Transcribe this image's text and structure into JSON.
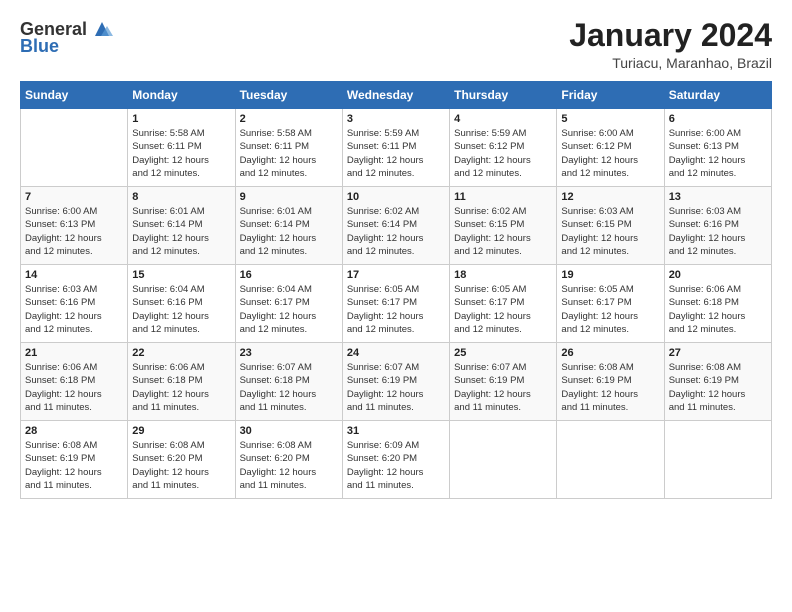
{
  "logo": {
    "general": "General",
    "blue": "Blue"
  },
  "title": "January 2024",
  "subtitle": "Turiacu, Maranhao, Brazil",
  "days_of_week": [
    "Sunday",
    "Monday",
    "Tuesday",
    "Wednesday",
    "Thursday",
    "Friday",
    "Saturday"
  ],
  "weeks": [
    [
      {
        "day": "",
        "info": ""
      },
      {
        "day": "1",
        "info": "Sunrise: 5:58 AM\nSunset: 6:11 PM\nDaylight: 12 hours\nand 12 minutes."
      },
      {
        "day": "2",
        "info": "Sunrise: 5:58 AM\nSunset: 6:11 PM\nDaylight: 12 hours\nand 12 minutes."
      },
      {
        "day": "3",
        "info": "Sunrise: 5:59 AM\nSunset: 6:11 PM\nDaylight: 12 hours\nand 12 minutes."
      },
      {
        "day": "4",
        "info": "Sunrise: 5:59 AM\nSunset: 6:12 PM\nDaylight: 12 hours\nand 12 minutes."
      },
      {
        "day": "5",
        "info": "Sunrise: 6:00 AM\nSunset: 6:12 PM\nDaylight: 12 hours\nand 12 minutes."
      },
      {
        "day": "6",
        "info": "Sunrise: 6:00 AM\nSunset: 6:13 PM\nDaylight: 12 hours\nand 12 minutes."
      }
    ],
    [
      {
        "day": "7",
        "info": "Sunrise: 6:00 AM\nSunset: 6:13 PM\nDaylight: 12 hours\nand 12 minutes."
      },
      {
        "day": "8",
        "info": "Sunrise: 6:01 AM\nSunset: 6:14 PM\nDaylight: 12 hours\nand 12 minutes."
      },
      {
        "day": "9",
        "info": "Sunrise: 6:01 AM\nSunset: 6:14 PM\nDaylight: 12 hours\nand 12 minutes."
      },
      {
        "day": "10",
        "info": "Sunrise: 6:02 AM\nSunset: 6:14 PM\nDaylight: 12 hours\nand 12 minutes."
      },
      {
        "day": "11",
        "info": "Sunrise: 6:02 AM\nSunset: 6:15 PM\nDaylight: 12 hours\nand 12 minutes."
      },
      {
        "day": "12",
        "info": "Sunrise: 6:03 AM\nSunset: 6:15 PM\nDaylight: 12 hours\nand 12 minutes."
      },
      {
        "day": "13",
        "info": "Sunrise: 6:03 AM\nSunset: 6:16 PM\nDaylight: 12 hours\nand 12 minutes."
      }
    ],
    [
      {
        "day": "14",
        "info": "Sunrise: 6:03 AM\nSunset: 6:16 PM\nDaylight: 12 hours\nand 12 minutes."
      },
      {
        "day": "15",
        "info": "Sunrise: 6:04 AM\nSunset: 6:16 PM\nDaylight: 12 hours\nand 12 minutes."
      },
      {
        "day": "16",
        "info": "Sunrise: 6:04 AM\nSunset: 6:17 PM\nDaylight: 12 hours\nand 12 minutes."
      },
      {
        "day": "17",
        "info": "Sunrise: 6:05 AM\nSunset: 6:17 PM\nDaylight: 12 hours\nand 12 minutes."
      },
      {
        "day": "18",
        "info": "Sunrise: 6:05 AM\nSunset: 6:17 PM\nDaylight: 12 hours\nand 12 minutes."
      },
      {
        "day": "19",
        "info": "Sunrise: 6:05 AM\nSunset: 6:17 PM\nDaylight: 12 hours\nand 12 minutes."
      },
      {
        "day": "20",
        "info": "Sunrise: 6:06 AM\nSunset: 6:18 PM\nDaylight: 12 hours\nand 12 minutes."
      }
    ],
    [
      {
        "day": "21",
        "info": "Sunrise: 6:06 AM\nSunset: 6:18 PM\nDaylight: 12 hours\nand 11 minutes."
      },
      {
        "day": "22",
        "info": "Sunrise: 6:06 AM\nSunset: 6:18 PM\nDaylight: 12 hours\nand 11 minutes."
      },
      {
        "day": "23",
        "info": "Sunrise: 6:07 AM\nSunset: 6:18 PM\nDaylight: 12 hours\nand 11 minutes."
      },
      {
        "day": "24",
        "info": "Sunrise: 6:07 AM\nSunset: 6:19 PM\nDaylight: 12 hours\nand 11 minutes."
      },
      {
        "day": "25",
        "info": "Sunrise: 6:07 AM\nSunset: 6:19 PM\nDaylight: 12 hours\nand 11 minutes."
      },
      {
        "day": "26",
        "info": "Sunrise: 6:08 AM\nSunset: 6:19 PM\nDaylight: 12 hours\nand 11 minutes."
      },
      {
        "day": "27",
        "info": "Sunrise: 6:08 AM\nSunset: 6:19 PM\nDaylight: 12 hours\nand 11 minutes."
      }
    ],
    [
      {
        "day": "28",
        "info": "Sunrise: 6:08 AM\nSunset: 6:19 PM\nDaylight: 12 hours\nand 11 minutes."
      },
      {
        "day": "29",
        "info": "Sunrise: 6:08 AM\nSunset: 6:20 PM\nDaylight: 12 hours\nand 11 minutes."
      },
      {
        "day": "30",
        "info": "Sunrise: 6:08 AM\nSunset: 6:20 PM\nDaylight: 12 hours\nand 11 minutes."
      },
      {
        "day": "31",
        "info": "Sunrise: 6:09 AM\nSunset: 6:20 PM\nDaylight: 12 hours\nand 11 minutes."
      },
      {
        "day": "",
        "info": ""
      },
      {
        "day": "",
        "info": ""
      },
      {
        "day": "",
        "info": ""
      }
    ]
  ]
}
